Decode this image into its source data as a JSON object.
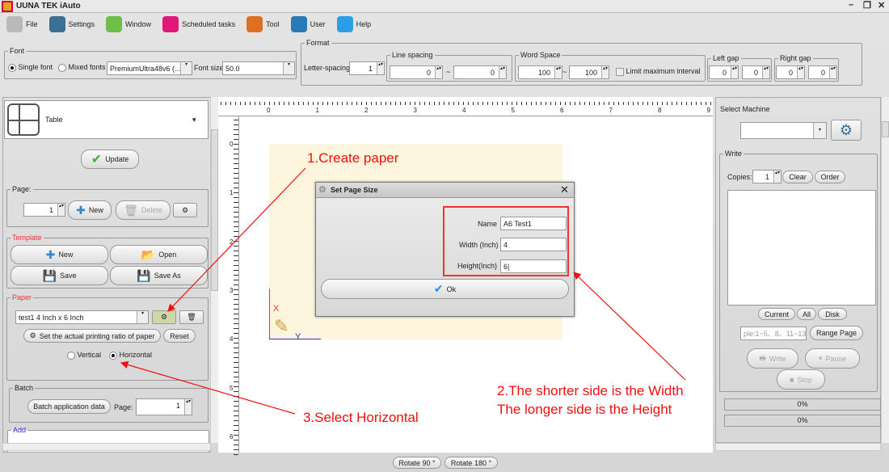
{
  "app": {
    "title": "UUNA TEK iAuto"
  },
  "menu": [
    {
      "label": "File",
      "icon": "file-icon",
      "color": "#b9b9b9"
    },
    {
      "label": "Settings",
      "icon": "gear-icon",
      "color": "#3a6f96"
    },
    {
      "label": "Window",
      "icon": "window-icon",
      "color": "#6cc04a"
    },
    {
      "label": "Scheduled tasks",
      "icon": "calendar-icon",
      "color": "#e0187a"
    },
    {
      "label": "Tool",
      "icon": "hammer-icon",
      "color": "#e07020"
    },
    {
      "label": "User",
      "icon": "user-icon",
      "color": "#2a7ab8"
    },
    {
      "label": "Help",
      "icon": "help-icon",
      "color": "#2b9ee8"
    }
  ],
  "font": {
    "legend": "Font",
    "single": "Single font",
    "mixed": "Mixed fonts",
    "font_name": "PremiumUltra48v6 (...",
    "size_label": "Font size",
    "size": "50.0"
  },
  "format": {
    "legend": "Format",
    "letter_spacing_label": "Letter-spacing",
    "letter_spacing": "1",
    "line_spacing_label": "Line spacing",
    "line_min": "0",
    "line_max": "0",
    "word_space_label": "Word Space",
    "word_min": "100",
    "word_max": "100",
    "limit_label": "Limit maximum interval",
    "left_gap_label": "Left gap",
    "left_min": "0",
    "left_max": "0",
    "right_gap_label": "Right gap",
    "right_min": "0",
    "right_max": "0",
    "tilde": "~"
  },
  "left": {
    "element_type": "Table",
    "update": "Update",
    "page_legend": "Page:",
    "page": "1",
    "new": "New",
    "delete": "Delete",
    "template_legend": "Template",
    "t_new": "New",
    "t_open": "Open",
    "t_save": "Save",
    "t_saveas": "Save As",
    "paper_legend": "Paper",
    "paper": "test1 4 Inch x 6 Inch",
    "ratio": "Set the actual printing ratio of paper",
    "reset": "Reset",
    "vertical": "Vertical",
    "horizontal": "Horizontal",
    "batch_legend": "Batch",
    "batch_btn": "Batch application data",
    "batch_page_label": "Page:",
    "batch_page": "1",
    "add_legend": "Add"
  },
  "ruler": {
    "h": [
      "0",
      "1",
      "2",
      "3",
      "4",
      "5",
      "6",
      "7",
      "8",
      "9"
    ],
    "v": [
      "0",
      "1",
      "2",
      "3",
      "4",
      "5",
      "6"
    ]
  },
  "canvas": {
    "axis_x": "X",
    "axis_y": "Y"
  },
  "dialog": {
    "title": "Set Page Size",
    "name_label": "Name",
    "name": "A6 Test1",
    "width_label": "Width (Inch)",
    "width": "4",
    "height_label": "Height(Inch)",
    "height": "6",
    "ok": "Ok"
  },
  "annotations": {
    "a1": "1.Create paper",
    "a2_line1": "2.The shorter side is the Width",
    "a2_line2": "The longer side is the Height",
    "a3": "3.Select Horizontal"
  },
  "right": {
    "select_machine": "Select Machine",
    "write_legend": "Write",
    "copies_label": "Copies:",
    "copies": "1",
    "clear": "Clear",
    "order": "Order",
    "current": "Current",
    "all": "All",
    "disk": "Disk",
    "range_placeholder": "ple:1~5、8、11~13",
    "range_page": "Range Page",
    "write": "Write",
    "pause": "Pause",
    "stop": "Stop",
    "progress1": "0%",
    "progress2": "0%",
    "progress1_value": 0,
    "progress2_value": 0
  },
  "bottom": {
    "rotate90": "Rotate 90 °",
    "rotate180": "Rotate 180 °"
  }
}
